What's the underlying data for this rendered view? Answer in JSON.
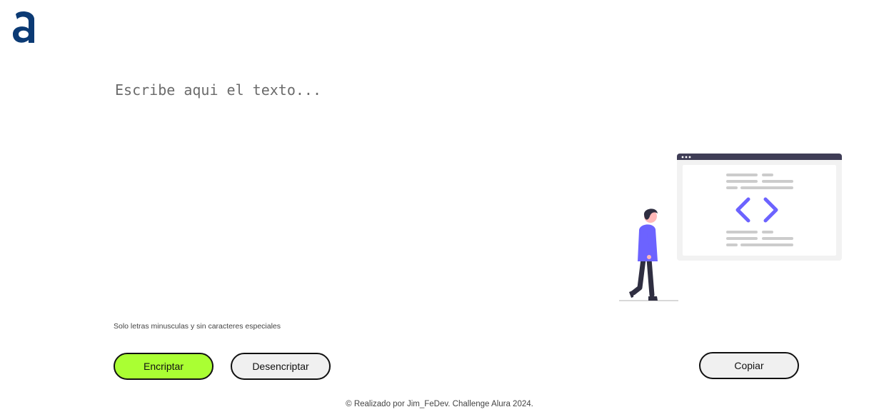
{
  "logo": {
    "icon": "alura-logo-icon",
    "color": "#0b3a74"
  },
  "editor": {
    "placeholder": "Escribe aqui el texto..."
  },
  "hint": {
    "text": "Solo letras minusculas y sin caracteres especiales"
  },
  "buttons": {
    "encrypt_label": "Encriptar",
    "decrypt_label": "Desencriptar",
    "copy_label": "Copiar"
  },
  "illustration": {
    "icon": "person-code-illustration",
    "accent": "#6c63ff"
  },
  "footer": {
    "text": "© Realizado por Jim_FeDev. Challenge Alura 2024."
  },
  "colors": {
    "encrypt_button": "#aaff33",
    "secondary_button": "#f0f0f0"
  }
}
